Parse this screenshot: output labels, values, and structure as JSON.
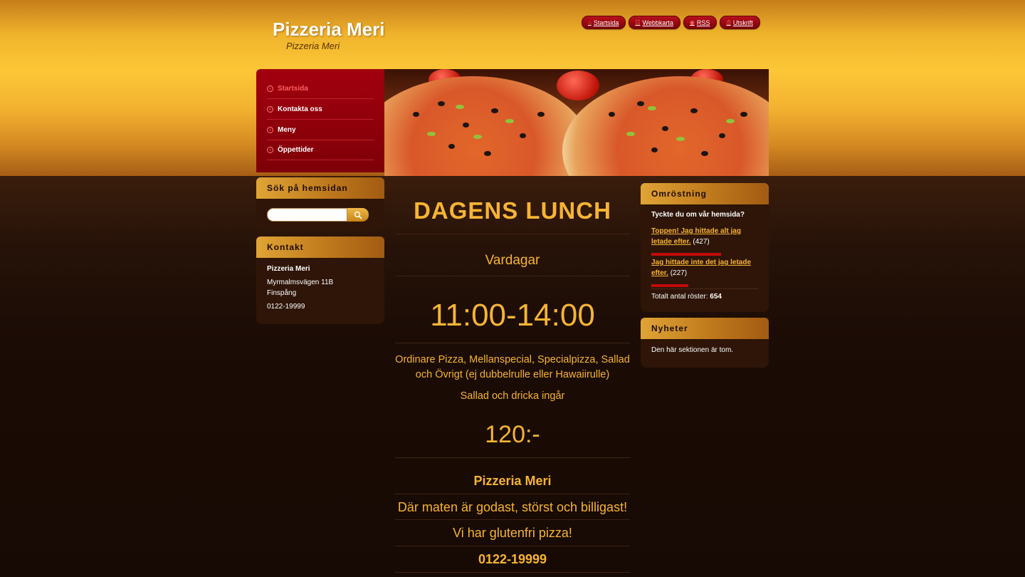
{
  "header": {
    "title": "Pizzeria Meri",
    "subtitle": "Pizzeria Meri",
    "quick_links": [
      {
        "label": "Startsida",
        "icon": "home-icon"
      },
      {
        "label": "Webbkarta",
        "icon": "sitemap-icon"
      },
      {
        "label": "RSS",
        "icon": "rss-icon"
      },
      {
        "label": "Utskrift",
        "icon": "print-icon"
      }
    ]
  },
  "nav": {
    "items": [
      {
        "label": "Startsida",
        "active": true
      },
      {
        "label": "Kontakta oss",
        "active": false
      },
      {
        "label": "Meny",
        "active": false
      },
      {
        "label": "Öppettider",
        "active": false
      }
    ]
  },
  "search": {
    "heading": "Sök på hemsidan",
    "placeholder": ""
  },
  "contact": {
    "heading": "Kontakt",
    "name": "Pizzeria Meri",
    "street": "Myrmalmsvägen 11B",
    "city": "Finspång",
    "phone": "0122-19999"
  },
  "main": {
    "title": "DAGENS LUNCH",
    "days": "Vardagar",
    "hours": "11:00-14:00",
    "description": "Ordinare Pizza, Mellanspecial, Specialpizza, Sallad och Övrigt (ej dubbelrulle eller Hawaiirulle)",
    "included": "Sallad och dricka ingår",
    "price": "120:-",
    "name": "Pizzeria Meri",
    "slogan": "Där maten är godast, störst och billigast!",
    "gluten": "Vi har glutenfri pizza!",
    "phone": "0122-19999"
  },
  "poll": {
    "heading": "Omröstning",
    "question": "Tyckte du om vår hemsida?",
    "options": [
      {
        "label": "Toppen! Jag hittade alt jag letade efter.",
        "count": "(427)",
        "share": 0.653
      },
      {
        "label": "Jag hittade inte det jag letade efter.",
        "count": "(227)",
        "share": 0.347
      }
    ],
    "total_label": "Totalt antal röster:",
    "total_value": "654"
  },
  "news": {
    "heading": "Nyheter",
    "empty_text": "Den här sektionen är tom."
  },
  "colors": {
    "accent": "#f6b434",
    "nav_red": "#a2000e",
    "poll_bar": "#c30a0a",
    "dark_bg": "#1a0c05"
  }
}
